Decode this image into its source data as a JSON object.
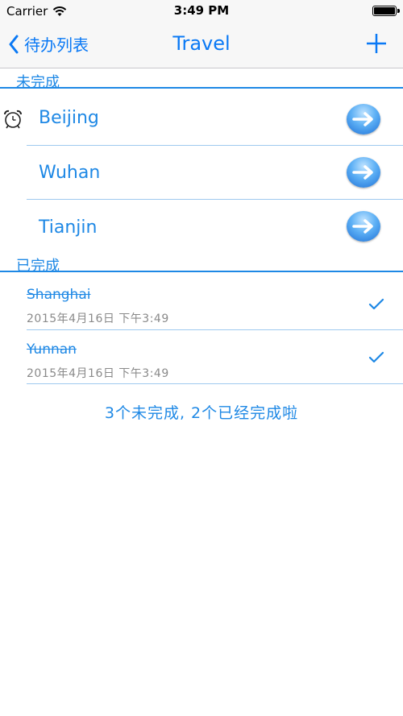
{
  "status_bar": {
    "carrier": "Carrier",
    "time": "3:49 PM",
    "battery_level": 1.0
  },
  "nav": {
    "back_label": "待办列表",
    "title": "Travel",
    "add_icon": "plus-icon"
  },
  "sections": {
    "pending_header": "未完成",
    "done_header": "已完成"
  },
  "pending_items": [
    {
      "name": "Beijing",
      "alarm": true
    },
    {
      "name": "Wuhan",
      "alarm": false
    },
    {
      "name": "Tianjin",
      "alarm": false
    }
  ],
  "done_items": [
    {
      "name": "Shanghai",
      "date": "2015年4月16日 下午3:49"
    },
    {
      "name": "Yunnan",
      "date": "2015年4月16日 下午3:49"
    }
  ],
  "summary": "3个未完成, 2个已经完成啦",
  "colors": {
    "accent": "#1e88e5",
    "nav_tint": "#0a79f5"
  }
}
